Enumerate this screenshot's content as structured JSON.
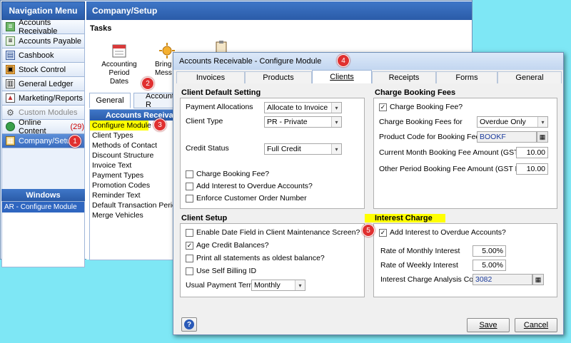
{
  "nav": {
    "title": "Navigation Menu",
    "items": [
      {
        "label": "Accounts Receivable",
        "icon": "ledger-icon"
      },
      {
        "label": "Accounts Payable",
        "icon": "ledger-icon"
      },
      {
        "label": "Cashbook",
        "icon": "cashbook-icon"
      },
      {
        "label": "Stock Control",
        "icon": "stock-icon"
      },
      {
        "label": "General Ledger",
        "icon": "ledger-book-icon"
      },
      {
        "label": "Marketing/Reports",
        "icon": "chart-icon"
      },
      {
        "label": "Custom Modules",
        "icon": "gear-icon"
      },
      {
        "label": "Online Content",
        "icon": "globe-icon",
        "count": "(29)"
      },
      {
        "label": "Company/Setup",
        "icon": "company-icon"
      }
    ],
    "windows_title": "Windows",
    "windows": [
      "AR - Configure Module"
    ]
  },
  "pane": {
    "title": "Company/Setup",
    "tasks_title": "Tasks",
    "tasks": [
      {
        "line1": "Accounting",
        "line2": "Period Dates"
      },
      {
        "line1": "Bring",
        "line2": "Mess"
      }
    ],
    "tabs": [
      "General",
      "Accounts R"
    ]
  },
  "module_list": {
    "header": "Accounts Receivable",
    "items": [
      "Configure Module",
      "Client Types",
      "Methods of Contact",
      "Discount Structure",
      "Invoice Text",
      "Payment Types",
      "Promotion Codes",
      "Reminder Text",
      "Default Transaction Period",
      "Merge Vehicles"
    ]
  },
  "badges": [
    "1",
    "2",
    "3",
    "4",
    "5"
  ],
  "dialog": {
    "title": "Accounts Receivable - Configure Module",
    "tabs": [
      "Invoices",
      "Products",
      "Clients",
      "Receipts",
      "Forms",
      "General"
    ],
    "client_default": {
      "title": "Client Default Setting",
      "payment_allocations_label": "Payment Allocations",
      "payment_allocations_value": "Allocate to Invoice",
      "client_type_label": "Client Type",
      "client_type_value": "PR - Private",
      "credit_status_label": "Credit Status",
      "credit_status_value": "Full Credit",
      "chk_booking_fee": "Charge Booking Fee?",
      "chk_interest": "Add Interest to Overdue Accounts?",
      "chk_order_number": "Enforce Customer Order Number"
    },
    "booking_fees": {
      "title": "Charge Booking Fees",
      "chk_booking_fee": "Charge Booking Fee?",
      "for_label": "Charge Booking Fees for",
      "for_value": "Overdue Only",
      "code_label": "Product Code for Booking Fee:",
      "code_value": "BOOKF",
      "current_label": "Current Month Booking Fee Amount (GST Excl)",
      "current_value": "10.00",
      "other_label": "Other Period Booking Fee Amount (GST Excl)",
      "other_value": "10.00"
    },
    "client_setup": {
      "title": "Client Setup",
      "chk_date_field": "Enable Date Field in Client Maintenance Screen?",
      "chk_age_credit": "Age Credit Balances?",
      "chk_print_all": "Print all statements as oldest balance?",
      "chk_self_billing": "Use Self Billing ID",
      "terms_label": "Usual Payment Terms",
      "terms_value": "Monthly"
    },
    "interest": {
      "title": "Interest Charge",
      "chk_interest": "Add Interest to Overdue Accounts?",
      "monthly_label": "Rate of Monthly Interest",
      "monthly_value": "5.00%",
      "weekly_label": "Rate of Weekly Interest",
      "weekly_value": "5.00%",
      "code_label": "Interest Charge Analysis Code",
      "code_value": "3082"
    },
    "help_label": "?",
    "save_label": "Save",
    "cancel_label": "Cancel"
  }
}
